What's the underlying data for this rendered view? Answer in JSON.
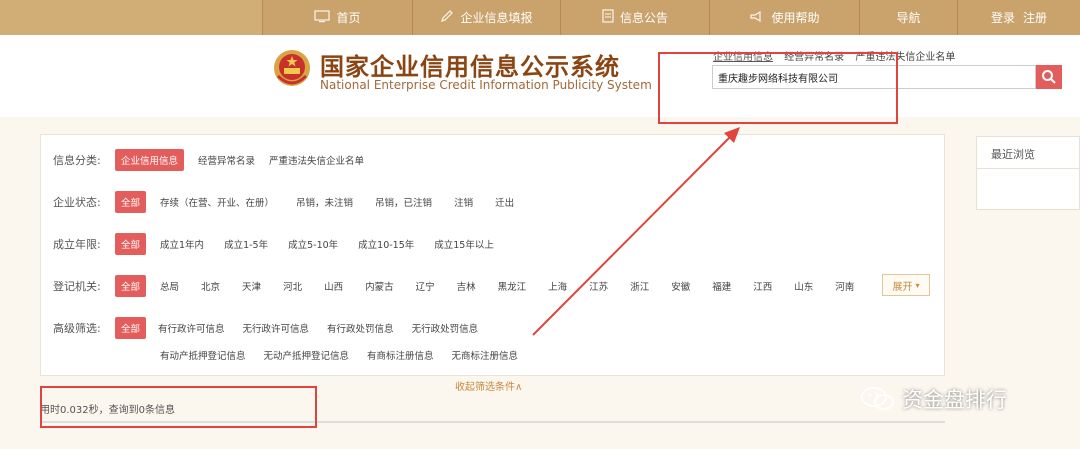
{
  "topnav": {
    "items": [
      {
        "label": "首页",
        "icon": "monitor-icon"
      },
      {
        "label": "企业信息填报",
        "icon": "pen-icon"
      },
      {
        "label": "信息公告",
        "icon": "document-icon"
      },
      {
        "label": "使用帮助",
        "icon": "megaphone-icon"
      },
      {
        "label": "导航",
        "icon": ""
      },
      {
        "label_a": "登录",
        "label_b": "注册"
      }
    ],
    "color": "#c9a36b"
  },
  "header": {
    "title_cn": "国家企业信用信息公示系统",
    "title_en": "National Enterprise Credit Information Publicity System",
    "title_color": "#8b4513"
  },
  "search": {
    "tabs": [
      "企业信用信息",
      "经营异常名录",
      "严重违法失信企业名单"
    ],
    "value": "重庆趣步网络科技有限公司",
    "button_color": "#e45d5d"
  },
  "filters": {
    "category": {
      "label": "信息分类:",
      "options": [
        "企业信用信息",
        "经营异常名录",
        "严重违法失信企业名单"
      ]
    },
    "status": {
      "label": "企业状态:",
      "options": [
        "全部",
        "存续（在营、开业、在册）",
        "吊销，未注销",
        "吊销，已注销",
        "注销",
        "迁出"
      ]
    },
    "years": {
      "label": "成立年限:",
      "options": [
        "全部",
        "成立1年内",
        "成立1-5年",
        "成立5-10年",
        "成立10-15年",
        "成立15年以上"
      ]
    },
    "authority": {
      "label": "登记机关:",
      "options": [
        "全部",
        "总局",
        "北京",
        "天津",
        "河北",
        "山西",
        "内蒙古",
        "辽宁",
        "吉林",
        "黑龙江",
        "上海",
        "江苏",
        "浙江",
        "安徽",
        "福建",
        "江西",
        "山东",
        "河南"
      ],
      "expand_label": "展开"
    },
    "advanced": {
      "label": "高级筛选:",
      "row1": [
        "全部",
        "有行政许可信息",
        "无行政许可信息",
        "有行政处罚信息",
        "无行政处罚信息"
      ],
      "row2": [
        "有动产抵押登记信息",
        "无动产抵押登记信息",
        "有商标注册信息",
        "无商标注册信息"
      ]
    },
    "collapse_label": "收起筛选条件∧",
    "accent": "#e45d5d"
  },
  "result": {
    "text": "用时0.032秒，查询到0条信息"
  },
  "recent": {
    "title": "最近浏览"
  },
  "watermark": {
    "text": "资金盘排行"
  },
  "annotation_color": "#e0443e"
}
